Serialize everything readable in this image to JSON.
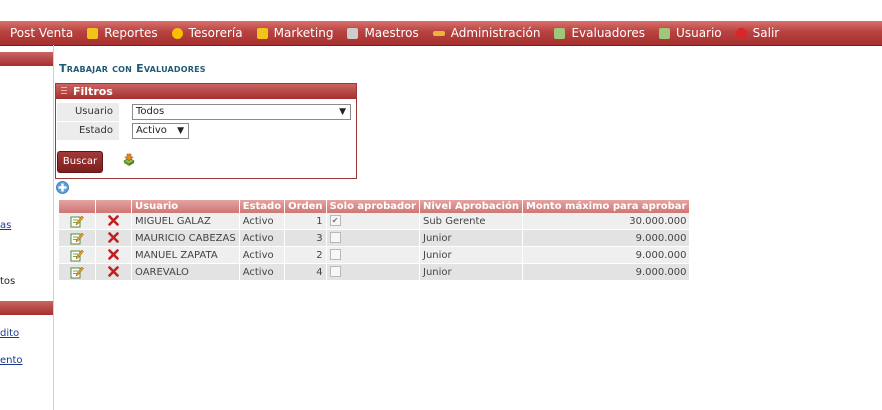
{
  "menu": [
    {
      "label": "Post Venta",
      "icon": "none"
    },
    {
      "label": "Reportes",
      "icon": "folder-icon",
      "color": "#f0c419"
    },
    {
      "label": "Tesorería",
      "icon": "coin-icon",
      "color": "#f5c000"
    },
    {
      "label": "Marketing",
      "icon": "folder-icon",
      "color": "#f0c419"
    },
    {
      "label": "Maestros",
      "icon": "database-icon",
      "color": "#cccccc"
    },
    {
      "label": "Administración",
      "icon": "key-icon",
      "color": "#e8b53a"
    },
    {
      "label": "Evaluadores",
      "icon": "image-icon",
      "color": "#9ec77a"
    },
    {
      "label": "Usuario",
      "icon": "image-icon",
      "color": "#9ec77a"
    },
    {
      "label": "Salir",
      "icon": "close-circle-icon",
      "color": "#d9262a"
    }
  ],
  "sidebar": {
    "fragments": [
      "as",
      "tos",
      "dito",
      "ento"
    ]
  },
  "page": {
    "title": "Trabajar con Evaluadores"
  },
  "filters": {
    "title": "Filtros",
    "usuario_label": "Usuario",
    "usuario_value": "Todos",
    "estado_label": "Estado",
    "estado_value": "Activo",
    "search_label": "Buscar"
  },
  "table": {
    "headers": [
      "",
      "",
      "Usuario",
      "Estado",
      "Orden",
      "Solo aprobador",
      "Nivel Aprobación",
      "Monto máximo para aprobar"
    ],
    "rows": [
      {
        "usuario": "MIGUEL GALAZ",
        "estado": "Activo",
        "orden": "1",
        "solo": true,
        "nivel": "Sub Gerente",
        "monto": "30.000.000"
      },
      {
        "usuario": "MAURICIO CABEZAS",
        "estado": "Activo",
        "orden": "3",
        "solo": false,
        "nivel": "Junior",
        "monto": "9.000.000"
      },
      {
        "usuario": "MANUEL ZAPATA",
        "estado": "Activo",
        "orden": "2",
        "solo": false,
        "nivel": "Junior",
        "monto": "9.000.000"
      },
      {
        "usuario": "OAREVALO",
        "estado": "Activo",
        "orden": "4",
        "solo": false,
        "nivel": "Junior",
        "monto": "9.000.000"
      }
    ]
  },
  "colors": {
    "menubar": "#b8423f",
    "title": "#1f5a75",
    "header": "#cf7774",
    "delete": "#c0201f",
    "link": "#1a3b8c"
  }
}
